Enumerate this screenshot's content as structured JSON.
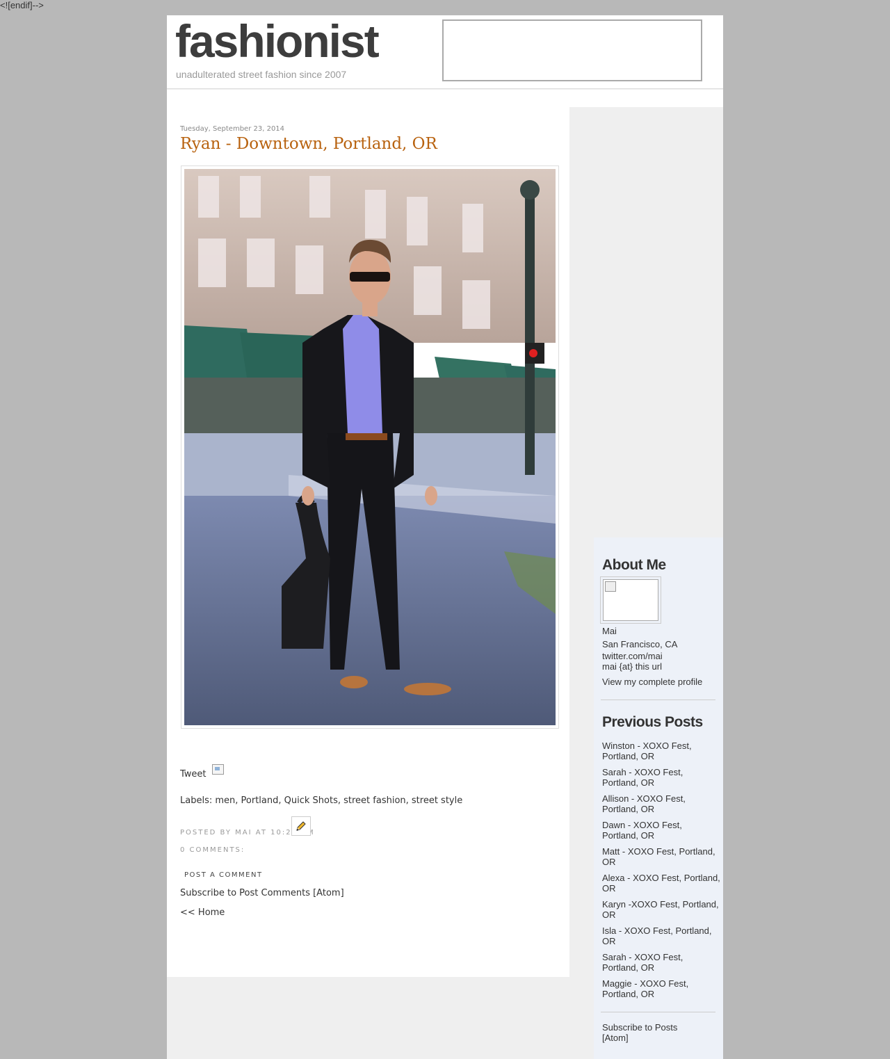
{
  "stray_text": "<![endif]-->",
  "header": {
    "title": "fashionist",
    "description": "unadulterated street fashion since 2007"
  },
  "post": {
    "date": "Tuesday, September 23, 2014",
    "title": "Ryan - Downtown, Portland, OR",
    "tweet_label": "Tweet",
    "labels_prefix": "Labels: ",
    "labels": [
      "men",
      "Portland",
      "Quick Shots",
      "street fashion",
      "street style"
    ],
    "posted_by": "Posted by Mai at 10:24 AM",
    "comments_count": "0 comments:",
    "post_comment": "Post a Comment",
    "subscribe_comments": "Subscribe to Post Comments [Atom]",
    "home_link": "<< Home"
  },
  "sidebar": {
    "about_title": "About Me",
    "profile_name": "Mai",
    "profile_location": "San Francisco, CA",
    "profile_twitter": "twitter.com/mai",
    "profile_email": "mai {at} this url",
    "profile_link": "View my complete profile",
    "previous_title": "Previous Posts",
    "previous_posts": [
      "Winston - XOXO Fest, Portland, OR",
      "Sarah - XOXO Fest, Portland, OR",
      "Allison - XOXO Fest, Portland, OR",
      "Dawn - XOXO Fest, Portland, OR",
      "Matt - XOXO Fest, Portland, OR",
      "Alexa - XOXO Fest, Portland, OR",
      "Karyn -XOXO Fest, Portland, OR",
      "Isla - XOXO Fest, Portland, OR",
      "Sarah - XOXO Fest, Portland, OR",
      "Maggie - XOXO Fest, Portland, OR"
    ],
    "subscribe_posts": "Subscribe to Posts [Atom]"
  },
  "colors": {
    "post_title": "#b8620f",
    "sidebar_bg": "#edf1f8",
    "page_bg": "#b8b8b8"
  },
  "icons": {
    "edit": "pencil-icon"
  }
}
